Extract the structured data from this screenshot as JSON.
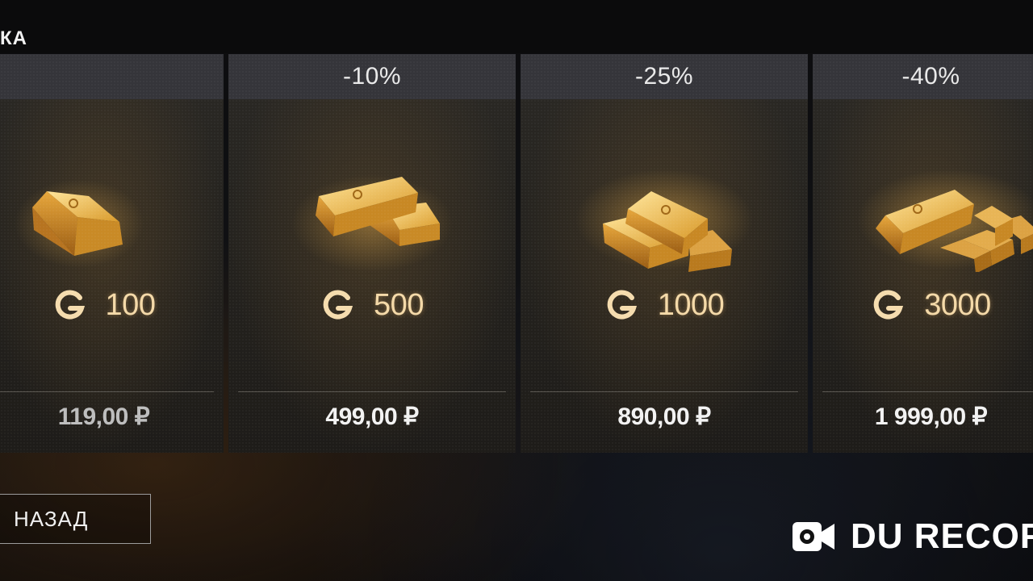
{
  "header": {
    "title": "КА"
  },
  "offers": [
    {
      "discount": "",
      "amount": "100",
      "price": "119,00 ₽",
      "bars_icon": "gold-bar-single-icon"
    },
    {
      "discount": "-10%",
      "amount": "500",
      "price": "499,00 ₽",
      "bars_icon": "gold-bars-two-icon"
    },
    {
      "discount": "-25%",
      "amount": "1000",
      "price": "890,00 ₽",
      "bars_icon": "gold-bars-stack-icon"
    },
    {
      "discount": "-40%",
      "amount": "3000",
      "price": "1 999,00 ₽",
      "bars_icon": "gold-bars-pile-icon"
    }
  ],
  "currency_icon": "gold-currency-g-icon",
  "footer": {
    "back_label": "НАЗАД"
  },
  "watermark": {
    "text": "DU RECOF",
    "icon": "video-camera-icon"
  },
  "colors": {
    "gold": "#e3a93a",
    "card_header": "#35353a",
    "amount_text": "#f4d9a8"
  }
}
